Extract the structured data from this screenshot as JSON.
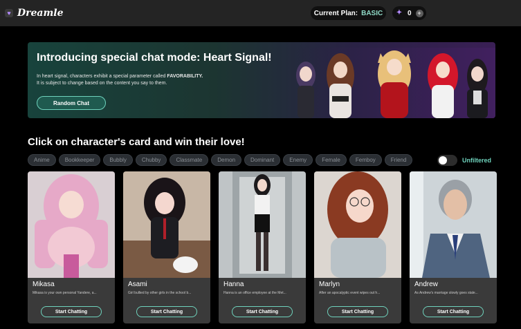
{
  "app": {
    "name": "Dreamle"
  },
  "header": {
    "plan_label": "Current Plan:",
    "plan_value": "BASIC",
    "credits": "0",
    "add_icon": "plus-icon",
    "gem_icon": "crystal-icon"
  },
  "banner": {
    "title": "Introducing special chat mode: Heart Signal!",
    "desc_line1_prefix": "In heart signal, characters exhibit a special parameter called ",
    "desc_line1_bold": "FAVORABILITY.",
    "desc_line2": "It is subject to change based on the content you say to them.",
    "button": "Random Chat"
  },
  "section": {
    "title": "Click on character's card and win their love!"
  },
  "tags": [
    "Anime",
    "Bookkeeper",
    "Bubbly",
    "Chubby",
    "Classmate",
    "Demon",
    "Dominant",
    "Enemy",
    "Female",
    "Femboy",
    "Friend"
  ],
  "filter": {
    "label": "Unfiltered"
  },
  "cards": [
    {
      "name": "Mikasa",
      "desc": "Mikasa is your own personal Yandere, a...",
      "button": "Start Chatting"
    },
    {
      "name": "Asami",
      "desc": "Girl bullied by other girls in the school b...",
      "button": "Start Chatting"
    },
    {
      "name": "Hanna",
      "desc": "Hanna is an office employee at the Met...",
      "button": "Start Chatting"
    },
    {
      "name": "Marlyn",
      "desc": "After an apocalyptic event wipes out h...",
      "button": "Start Chatting"
    },
    {
      "name": "Andrew",
      "desc": "As Andrew's marriage slowly goes stale...",
      "button": "Start Chatting"
    }
  ],
  "colors": {
    "accent": "#6fd3bd",
    "plan": "#8fd9c6",
    "gem": "#b58cff"
  }
}
